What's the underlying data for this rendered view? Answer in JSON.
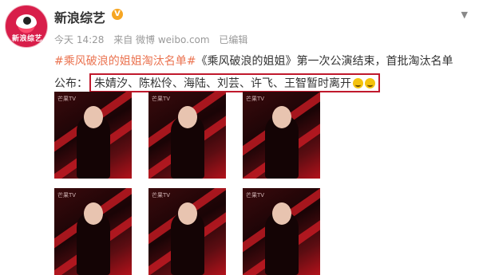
{
  "account": {
    "name": "新浪综艺",
    "avatar_text": "新浪综艺",
    "verified_badge": "V"
  },
  "meta": {
    "time": "今天 14:28",
    "source": "来自 微博 weibo.com",
    "edited": "已编辑"
  },
  "post": {
    "hashtag": "#乘风破浪的姐姐淘汰名单#",
    "line1_text": "《乘风破浪的姐姐》第一次公演结束，首批淘汰名单",
    "line2_prefix": "公布：",
    "highlighted_names": "朱婧汐、陈松伶、海陆、刘芸、许飞、王智暂时离开"
  },
  "photos": [
    {
      "watermark": "芒果TV"
    },
    {
      "watermark": "芒果TV"
    },
    {
      "watermark": "芒果TV"
    },
    {
      "watermark": "芒果TV"
    },
    {
      "watermark": "芒果TV"
    },
    {
      "watermark": "芒果TV"
    }
  ],
  "icons": {
    "caret": "chevron-down-icon",
    "emoji": "crying-face-icon"
  },
  "colors": {
    "hashtag": "#eb7350",
    "highlight_border": "#c0182c",
    "verified": "#f6a623"
  }
}
